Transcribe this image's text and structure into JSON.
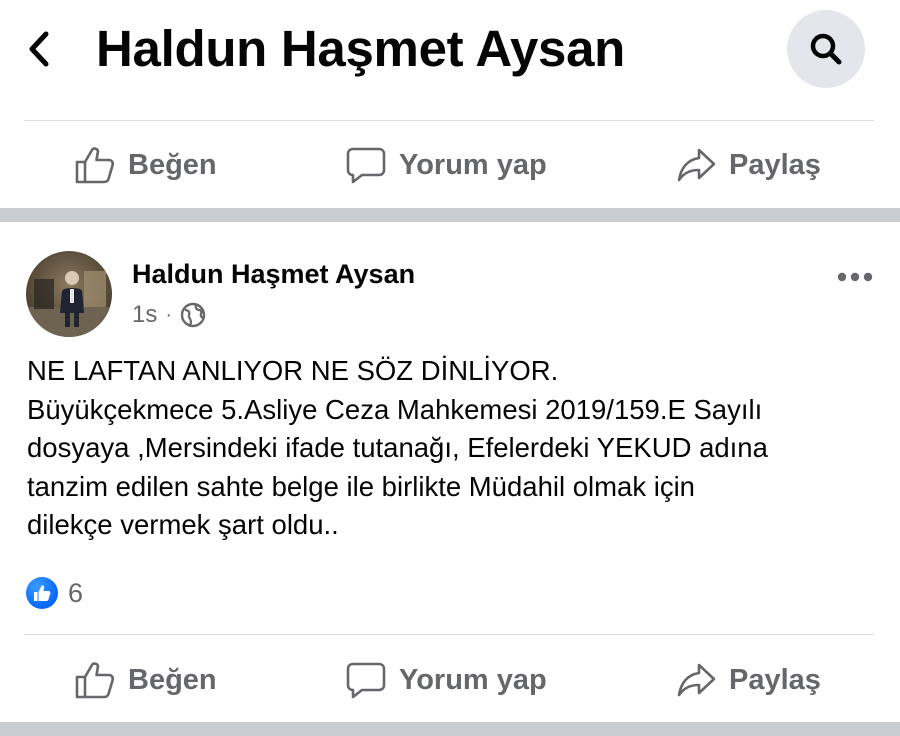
{
  "header": {
    "title": "Haldun Haşmet Aysan",
    "back_icon": "chevron-left-icon",
    "search_icon": "search-icon"
  },
  "top_actions": {
    "like_label": "Beğen",
    "comment_label": "Yorum yap",
    "share_label": "Paylaş"
  },
  "post": {
    "author": "Haldun Haşmet Aysan",
    "time": "1s",
    "separator": "·",
    "privacy_icon": "globe-icon",
    "more_icon": "more-dots-icon",
    "body_lines": [
      "NE LAFTAN ANLIYOR NE SÖZ DİNLİYOR.",
      "Büyükçekmece 5.Asliye Ceza Mahkemesi 2019/159.E Sayılı",
      "dosyaya ,Mersindeki ifade tutanağı, Efelerdeki YEKUD adına",
      "tanzim edilen sahte belge ile birlikte Müdahil olmak için",
      "dilekçe vermek şart oldu.."
    ],
    "reaction_count": "6",
    "actions": {
      "like_label": "Beğen",
      "comment_label": "Yorum yap",
      "share_label": "Paylaş"
    }
  },
  "colors": {
    "accent": "#0866ff",
    "secondary_text": "#65676b",
    "separator": "#c9ccd1",
    "search_bg": "#e4e6eb"
  }
}
